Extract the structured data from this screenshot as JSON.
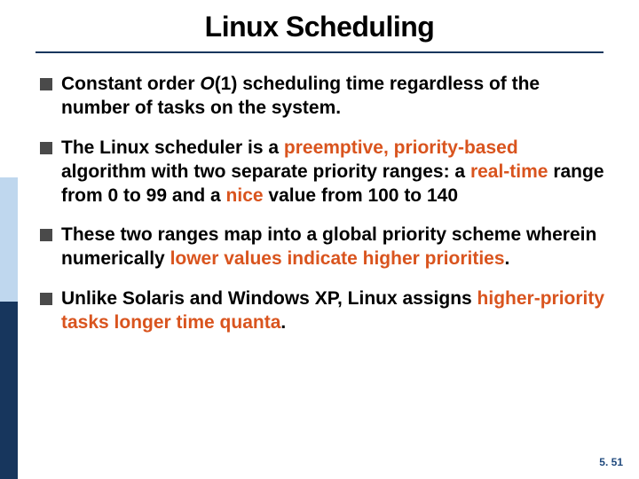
{
  "title": "Linux Scheduling",
  "bullets": {
    "b0": {
      "pre": "Constant order ",
      "em_o": "O",
      "em_n": "(1)",
      "post": " scheduling time regardless of the number of tasks on the system."
    },
    "b1": {
      "p0": "The Linux scheduler is a ",
      "h0": "preemptive, priority-based",
      "p1": " algorithm with two separate priority ranges: a ",
      "h1": "real-time",
      "p2": " range from 0 to 99 and a ",
      "h2": "nice",
      "p3": " value from 100 to 140"
    },
    "b2": {
      "p0": "These two ranges map into a global priority scheme wherein numerically ",
      "h0": "lower values indicate higher priorities",
      "p1": "."
    },
    "b3": {
      "p0": "Unlike Solaris and Windows XP, Linux assigns ",
      "h0": "higher-priority tasks longer time quanta",
      "p1": "."
    }
  },
  "page_number": "5. 51"
}
